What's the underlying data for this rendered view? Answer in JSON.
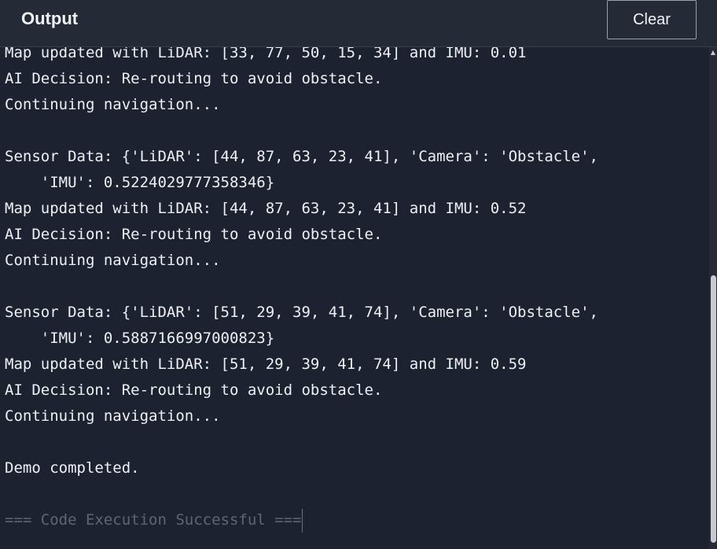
{
  "header": {
    "title": "Output",
    "clear_label": "Clear"
  },
  "output": {
    "lines": [
      "Map updated with LiDAR: [33, 77, 50, 15, 34] and IMU: 0.01",
      "AI Decision: Re-routing to avoid obstacle.",
      "Continuing navigation...",
      "",
      "Sensor Data: {'LiDAR': [44, 87, 63, 23, 41], 'Camera': 'Obstacle',",
      "    'IMU': 0.5224029777358346}",
      "Map updated with LiDAR: [44, 87, 63, 23, 41] and IMU: 0.52",
      "AI Decision: Re-routing to avoid obstacle.",
      "Continuing navigation...",
      "",
      "Sensor Data: {'LiDAR': [51, 29, 39, 41, 74], 'Camera': 'Obstacle',",
      "    'IMU': 0.5887166997000823}",
      "Map updated with LiDAR: [51, 29, 39, 41, 74] and IMU: 0.59",
      "AI Decision: Re-routing to avoid obstacle.",
      "Continuing navigation...",
      "",
      "Demo completed.",
      ""
    ],
    "status_line": "=== Code Execution Successful ==="
  },
  "colors": {
    "background": "#1d2230",
    "header_background": "#252a37",
    "text": "#eef0f3",
    "muted_text": "#5f6573"
  },
  "icons": {
    "scroll_up": "caret-up-icon"
  }
}
